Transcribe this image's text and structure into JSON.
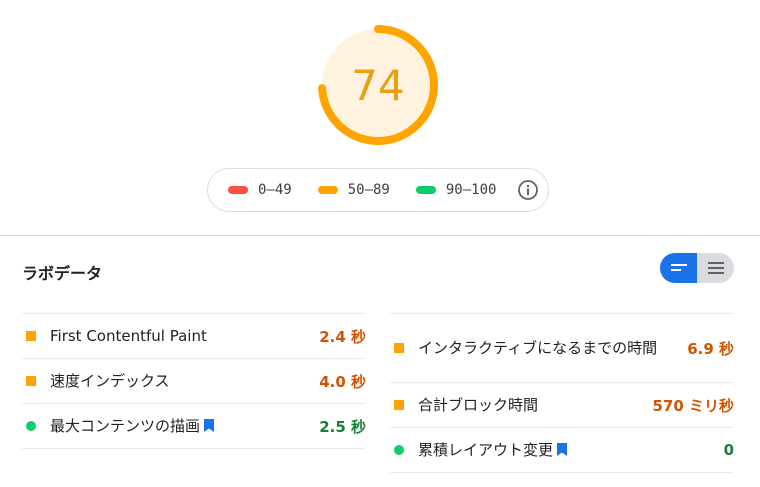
{
  "score": {
    "value": "74",
    "fraction": 0.74,
    "ring_color": "#ffa400",
    "bg_color": "#fff3e0",
    "text_color": "#e8a211"
  },
  "legend": {
    "items": [
      {
        "label": "0–49",
        "color": "#ff4e42"
      },
      {
        "label": "50–89",
        "color": "#ffa400"
      },
      {
        "label": "90–100",
        "color": "#0cce6b"
      }
    ],
    "info_icon": "info-icon"
  },
  "section": {
    "title": "ラボデータ"
  },
  "view_toggle": {
    "left_icon": "bar-view-icon",
    "right_icon": "list-view-icon",
    "active": "left"
  },
  "metrics": {
    "left": [
      {
        "label": "First Contentful Paint",
        "value": "2.4 秒",
        "status": "average",
        "bookmark": false
      },
      {
        "label": "速度インデックス",
        "value": "4.0 秒",
        "status": "average",
        "bookmark": false
      },
      {
        "label": "最大コンテンツの描画",
        "value": "2.5 秒",
        "status": "pass",
        "bookmark": true
      }
    ],
    "right": [
      {
        "label": "インタラクティブになるまでの時間",
        "value": "6.9 秒",
        "status": "average",
        "bookmark": false
      },
      {
        "label": "合計ブロック時間",
        "value": "570 ミリ秒",
        "status": "average",
        "bookmark": false
      },
      {
        "label": "累積レイアウト変更",
        "value": "0",
        "status": "pass",
        "bookmark": true
      }
    ]
  }
}
